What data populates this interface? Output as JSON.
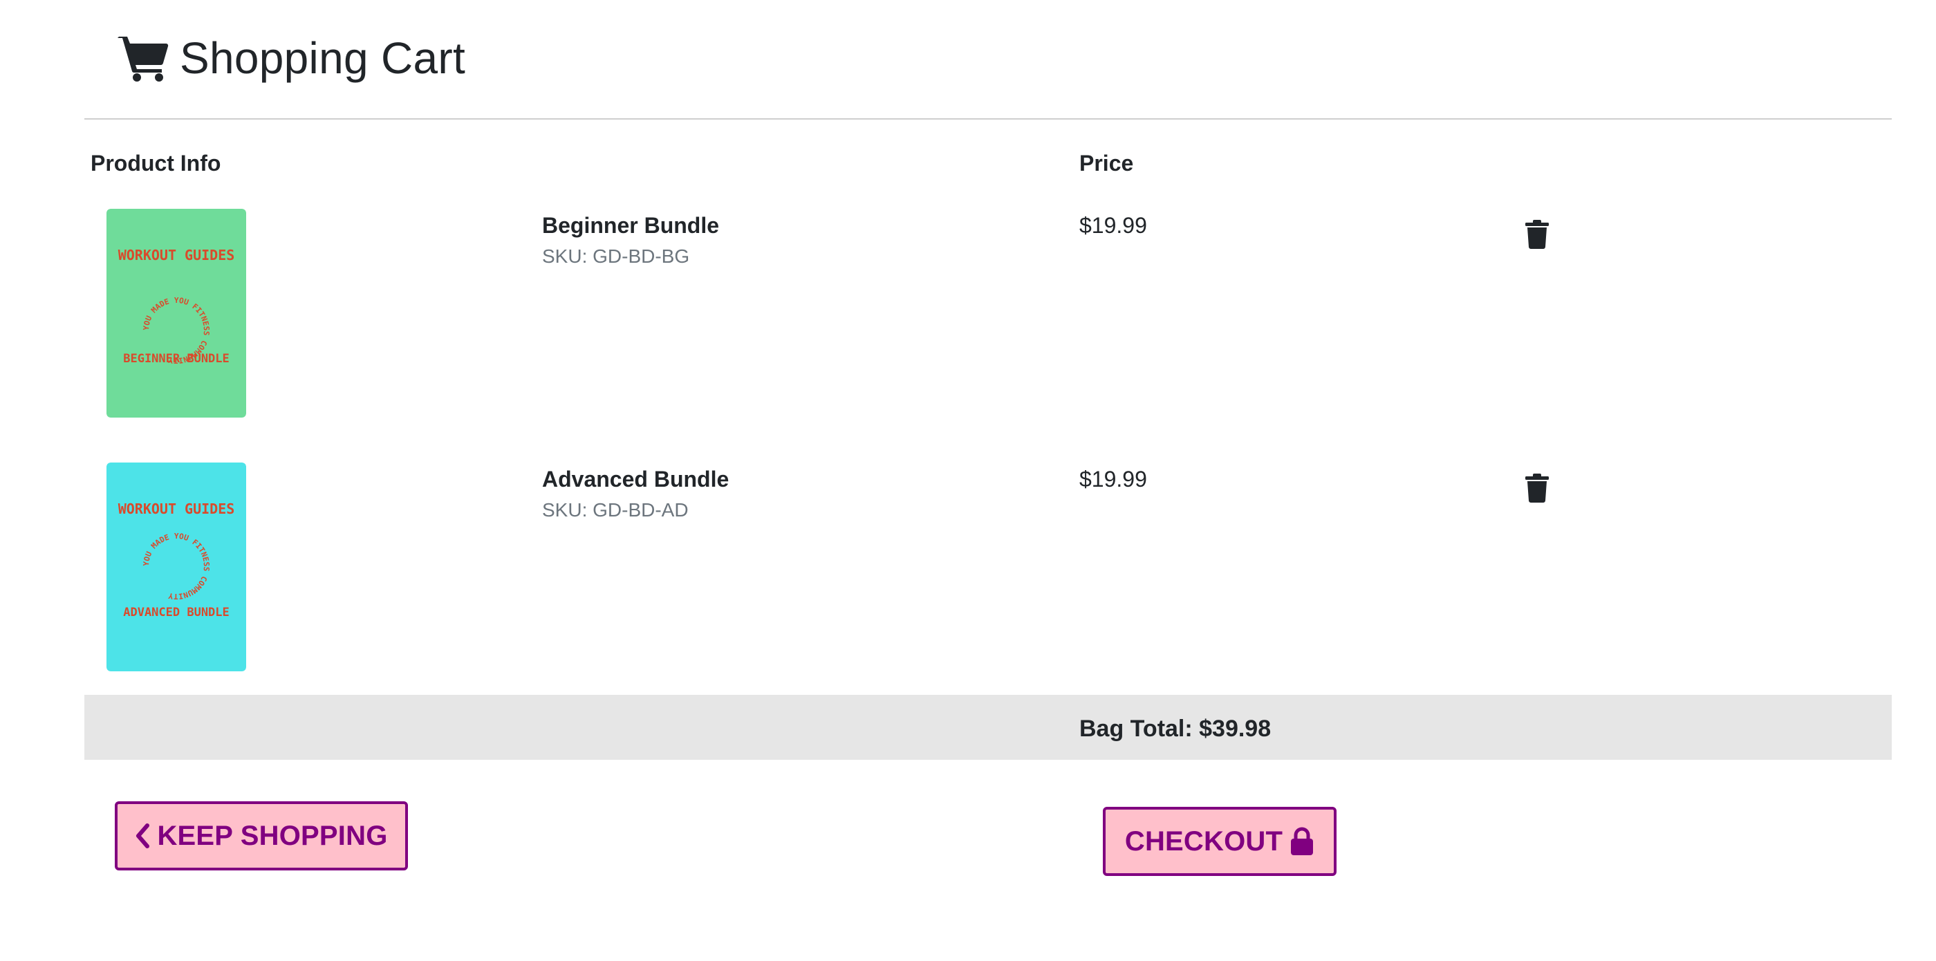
{
  "page": {
    "title": "Shopping Cart",
    "title_icon": "shopping-cart-icon"
  },
  "table": {
    "headers": {
      "product_info": "Product Info",
      "price": "Price"
    }
  },
  "items": [
    {
      "name": "Beginner Bundle",
      "sku": "SKU: GD-BD-BG",
      "price": "$19.99",
      "remove_icon": "trash-icon",
      "image": {
        "background": "#6fdc9a",
        "top_text": "WORKOUT GUIDES",
        "circle_text": "YOU MADE YOU FITNESS COMMUNITY",
        "bottom_text": "BEGINNER BUNDLE",
        "text_color": "#d94a2b"
      }
    },
    {
      "name": "Advanced Bundle",
      "sku": "SKU: GD-BD-AD",
      "price": "$19.99",
      "remove_icon": "trash-icon",
      "image": {
        "background": "#4de3e8",
        "top_text": "WORKOUT GUIDES",
        "circle_text": "YOU MADE YOU FITNESS COMMUNITY",
        "bottom_text": "ADVANCED BUNDLE",
        "text_color": "#d94a2b"
      }
    }
  ],
  "summary": {
    "bag_total": "Bag Total: $39.98"
  },
  "actions": {
    "keep_shopping": "KEEP SHOPPING",
    "keep_shopping_icon": "chevron-left-icon",
    "checkout": "CHECKOUT",
    "checkout_icon": "lock-icon"
  },
  "colors": {
    "button_bg": "#ffc0cb",
    "button_accent": "#800080",
    "total_bar_bg": "#e6e6e6",
    "text": "#212529",
    "muted": "#6c757d"
  }
}
